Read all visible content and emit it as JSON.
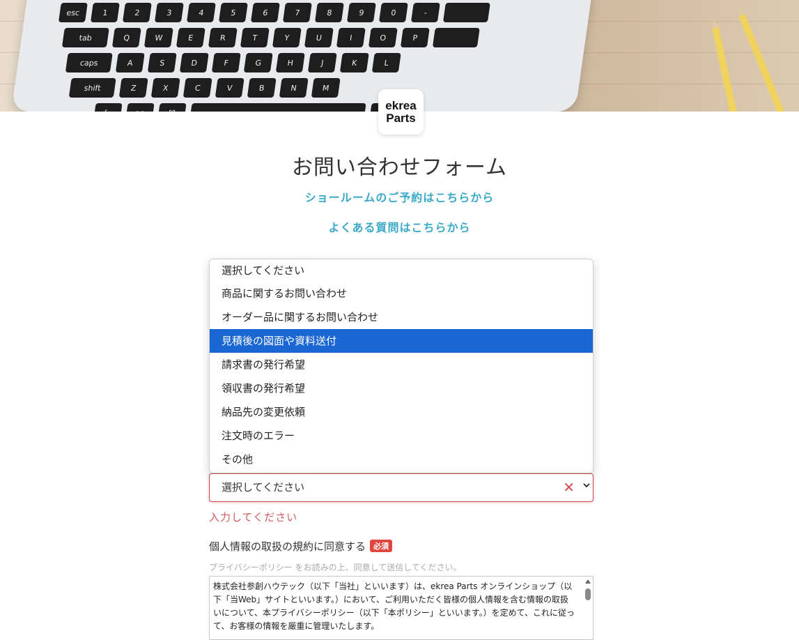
{
  "brand": {
    "logo_line1": "ekrea",
    "logo_line2": "Parts"
  },
  "page": {
    "title": "お問い合わせフォーム"
  },
  "links": {
    "showroom": "ショールームのご予約はこちらから",
    "faq": "よくある質問はこちらから"
  },
  "inquiry_select": {
    "options": [
      "選択してください",
      "商品に関するお問い合わせ",
      "オーダー品に関するお問い合わせ",
      "見積後の図面や資料送付",
      "請求書の発行希望",
      "領収書の発行希望",
      "納品先の変更依頼",
      "注文時のエラー",
      "その他"
    ],
    "highlighted_index": 3,
    "selected_value": "選択してください",
    "error": "入力してください"
  },
  "consent": {
    "label": "個人情報の取扱の規約に同意する",
    "required_badge": "必須",
    "hint": "プライバシーポリシー をお読みの上、同意して送信してください。",
    "policy_text": "株式会社参創ハウテック（以下「当社」といいます）は、ekrea Parts オンラインショップ（以下「当Web」サイトといいます。）において、ご利用いただく皆様の個人情報を含む情報の取扱いについて、本プライバシーポリシー（以下「本ポリシー」といいます。）を定めて、これに従って、お客様の情報を厳重に管理いたします。"
  },
  "colors": {
    "link": "#3aa9c8",
    "highlight": "#1a66d2",
    "error": "#d24a4c",
    "badge": "#e0463e"
  }
}
